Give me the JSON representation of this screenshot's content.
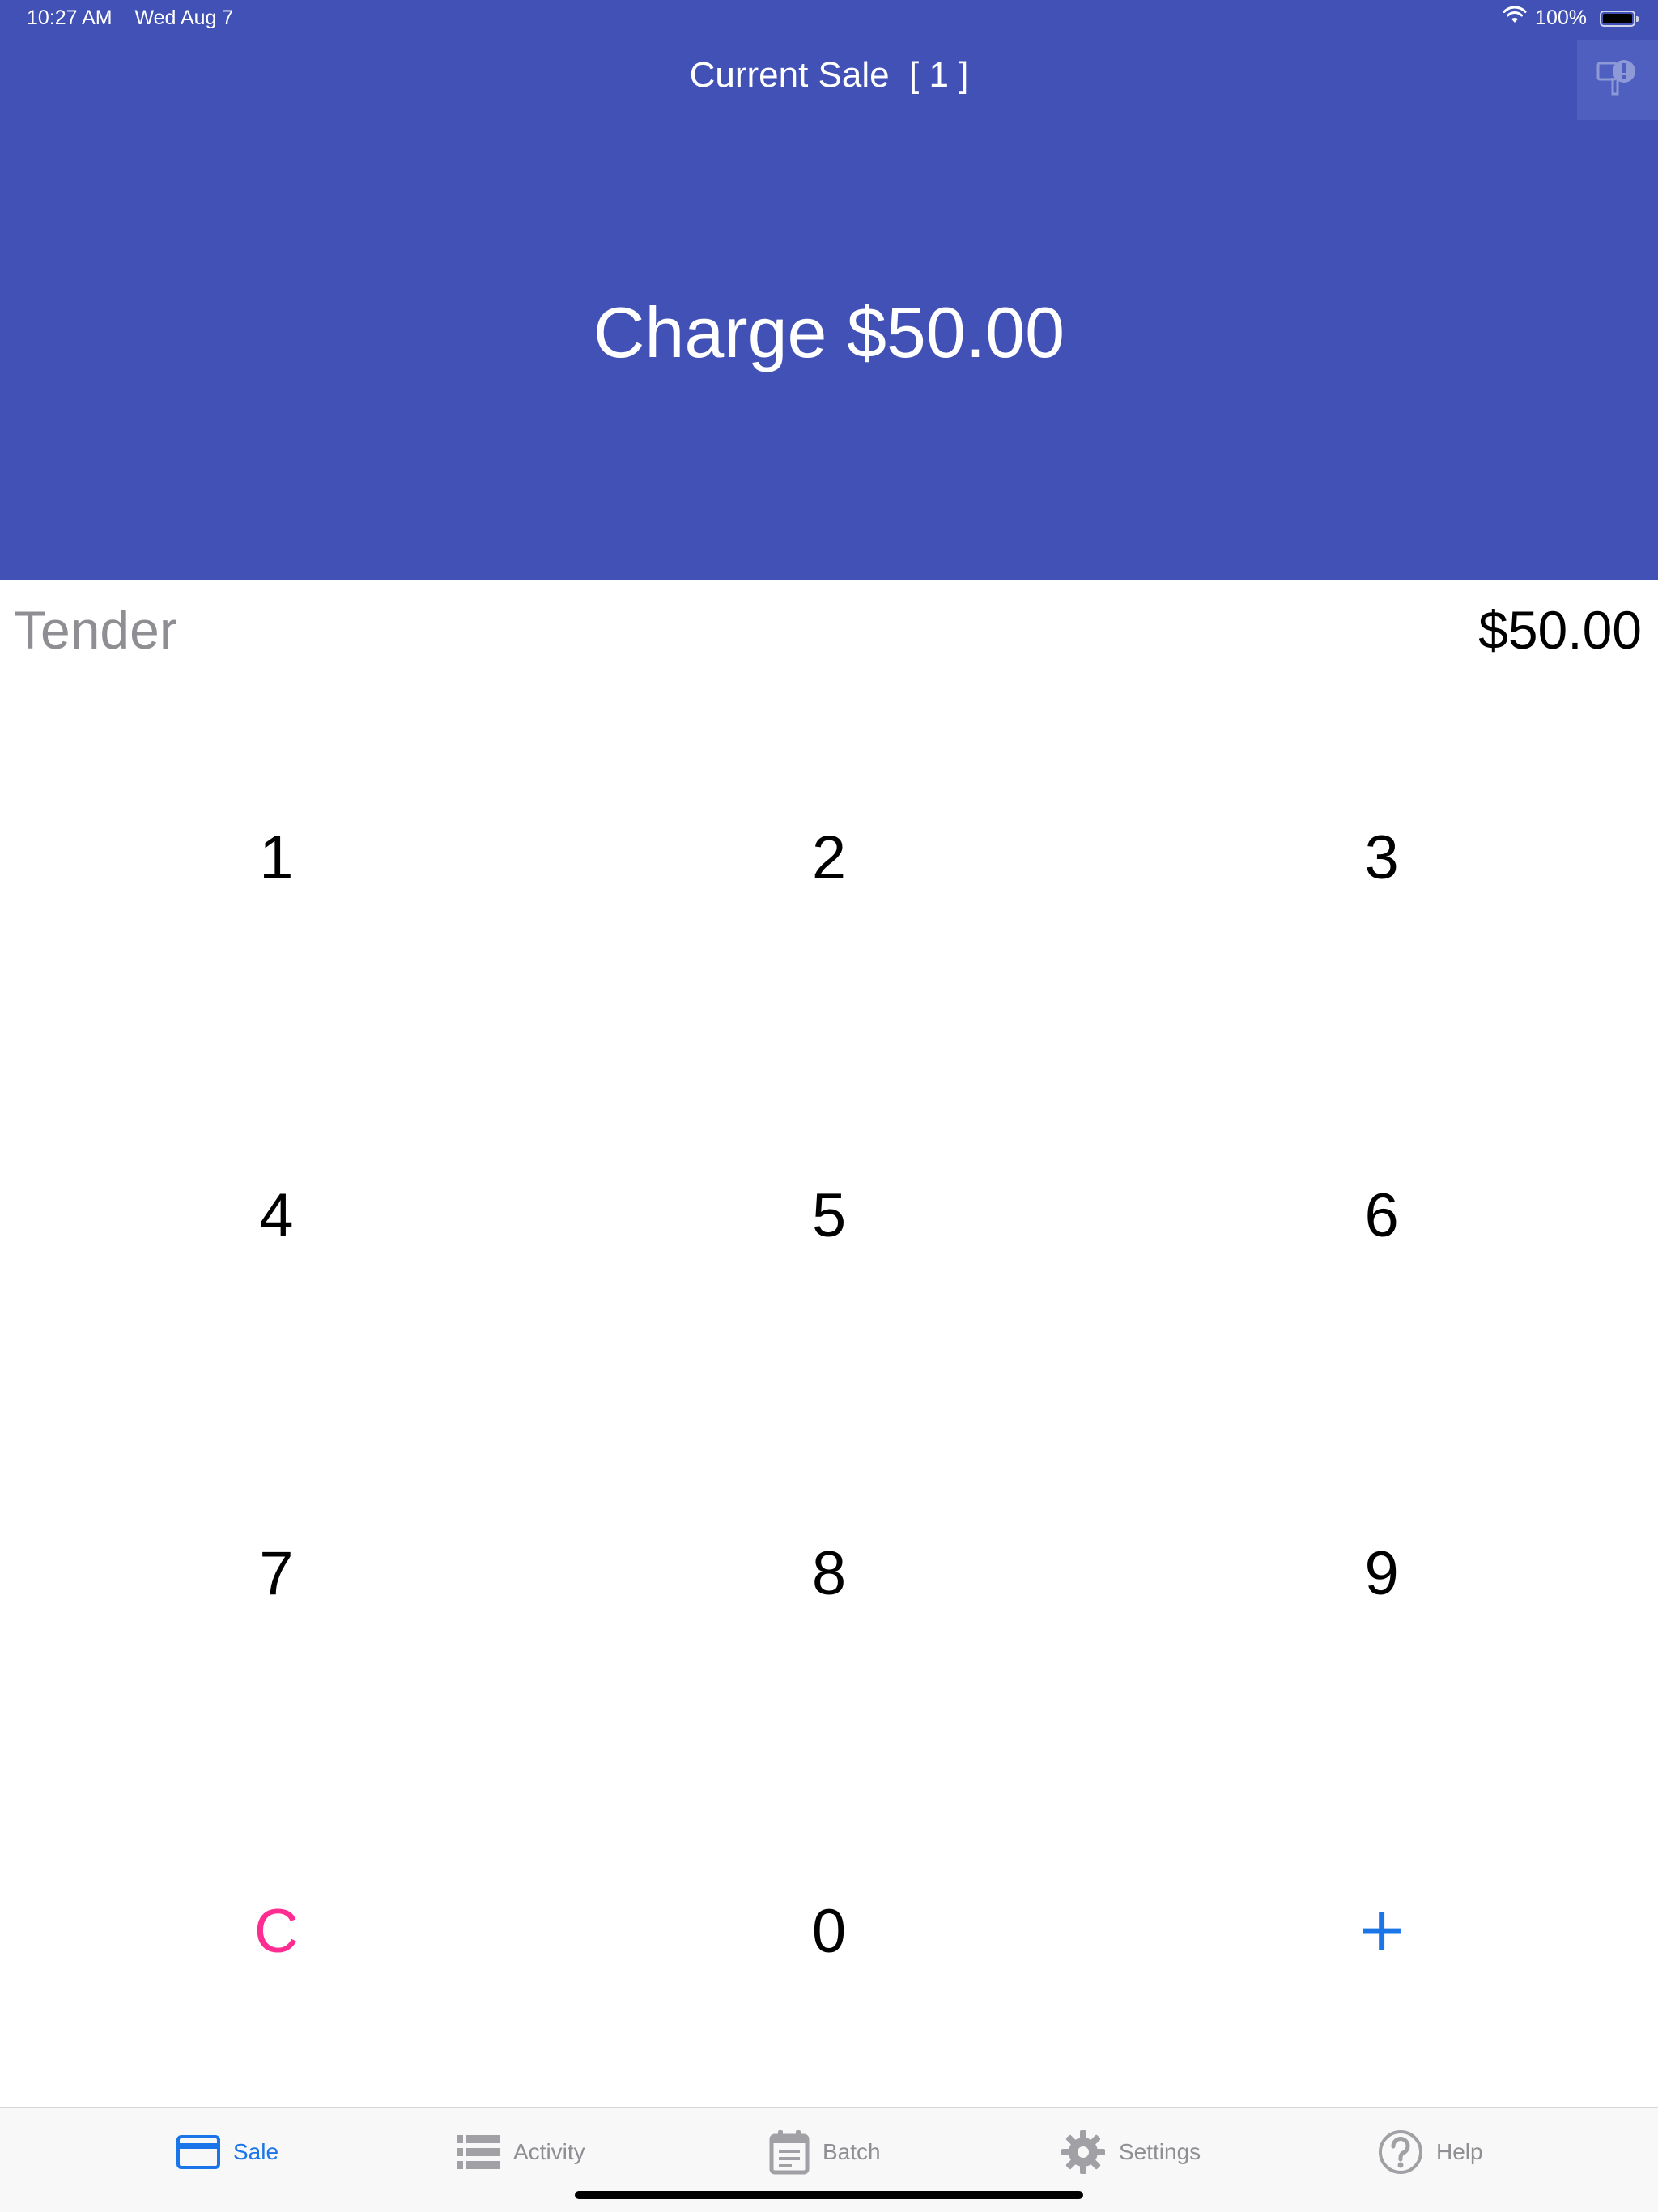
{
  "status_bar": {
    "time": "10:27 AM",
    "date": "Wed Aug 7",
    "battery": "100%"
  },
  "header": {
    "title": "Current Sale  [ 1 ]",
    "charge_label": "Charge $50.00",
    "background": "#4151b5"
  },
  "tender": {
    "label": "Tender",
    "amount": "$50.00"
  },
  "keypad": {
    "keys": [
      "1",
      "2",
      "3",
      "4",
      "5",
      "6",
      "7",
      "8",
      "9",
      "C",
      "0",
      "+"
    ],
    "clear_color": "#ff2d92",
    "plus_color": "#1a75e8"
  },
  "tabbar": {
    "active_color": "#1a75e8",
    "inactive_color": "#8e8e93",
    "items": [
      {
        "label": "Sale",
        "icon": "credit-card-icon",
        "active": true
      },
      {
        "label": "Activity",
        "icon": "list-icon",
        "active": false
      },
      {
        "label": "Batch",
        "icon": "calendar-icon",
        "active": false
      },
      {
        "label": "Settings",
        "icon": "gear-icon",
        "active": false
      },
      {
        "label": "Help",
        "icon": "question-icon",
        "active": false
      }
    ]
  }
}
